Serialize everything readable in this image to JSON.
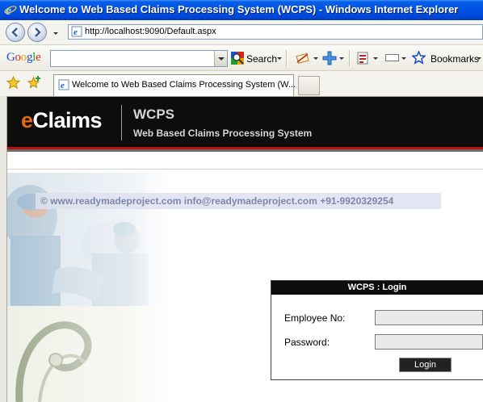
{
  "window": {
    "title": "Welcome to Web Based Claims Processing System (WCPS) - Windows Internet Explorer"
  },
  "address_bar": {
    "url": "http://localhost:9090/Default.aspx"
  },
  "google_toolbar": {
    "logo": "Google",
    "search_value": "",
    "search_label": "Search",
    "bookmarks_label": "Bookmarks"
  },
  "tabs": [
    {
      "label": "Welcome to Web Based Claims Processing System (W..."
    }
  ],
  "page": {
    "header": {
      "logo_prefix": "e",
      "logo_rest": "Claims",
      "title": "WCPS",
      "subtitle": "Web Based Claims Processing System"
    },
    "contact": "©  www.readymadeproject.com  info@readymadeproject.com  +91-9920329254",
    "login": {
      "title": "WCPS : Login",
      "employee_label": "Employee No:",
      "employee_value": "",
      "password_label": "Password:",
      "password_value": "",
      "button": "Login"
    }
  },
  "colors": {
    "titlebar": "#0055e5",
    "header_bg": "#0d0d0d",
    "header_accent": "#b81212",
    "logo_e": "#e36a13"
  }
}
